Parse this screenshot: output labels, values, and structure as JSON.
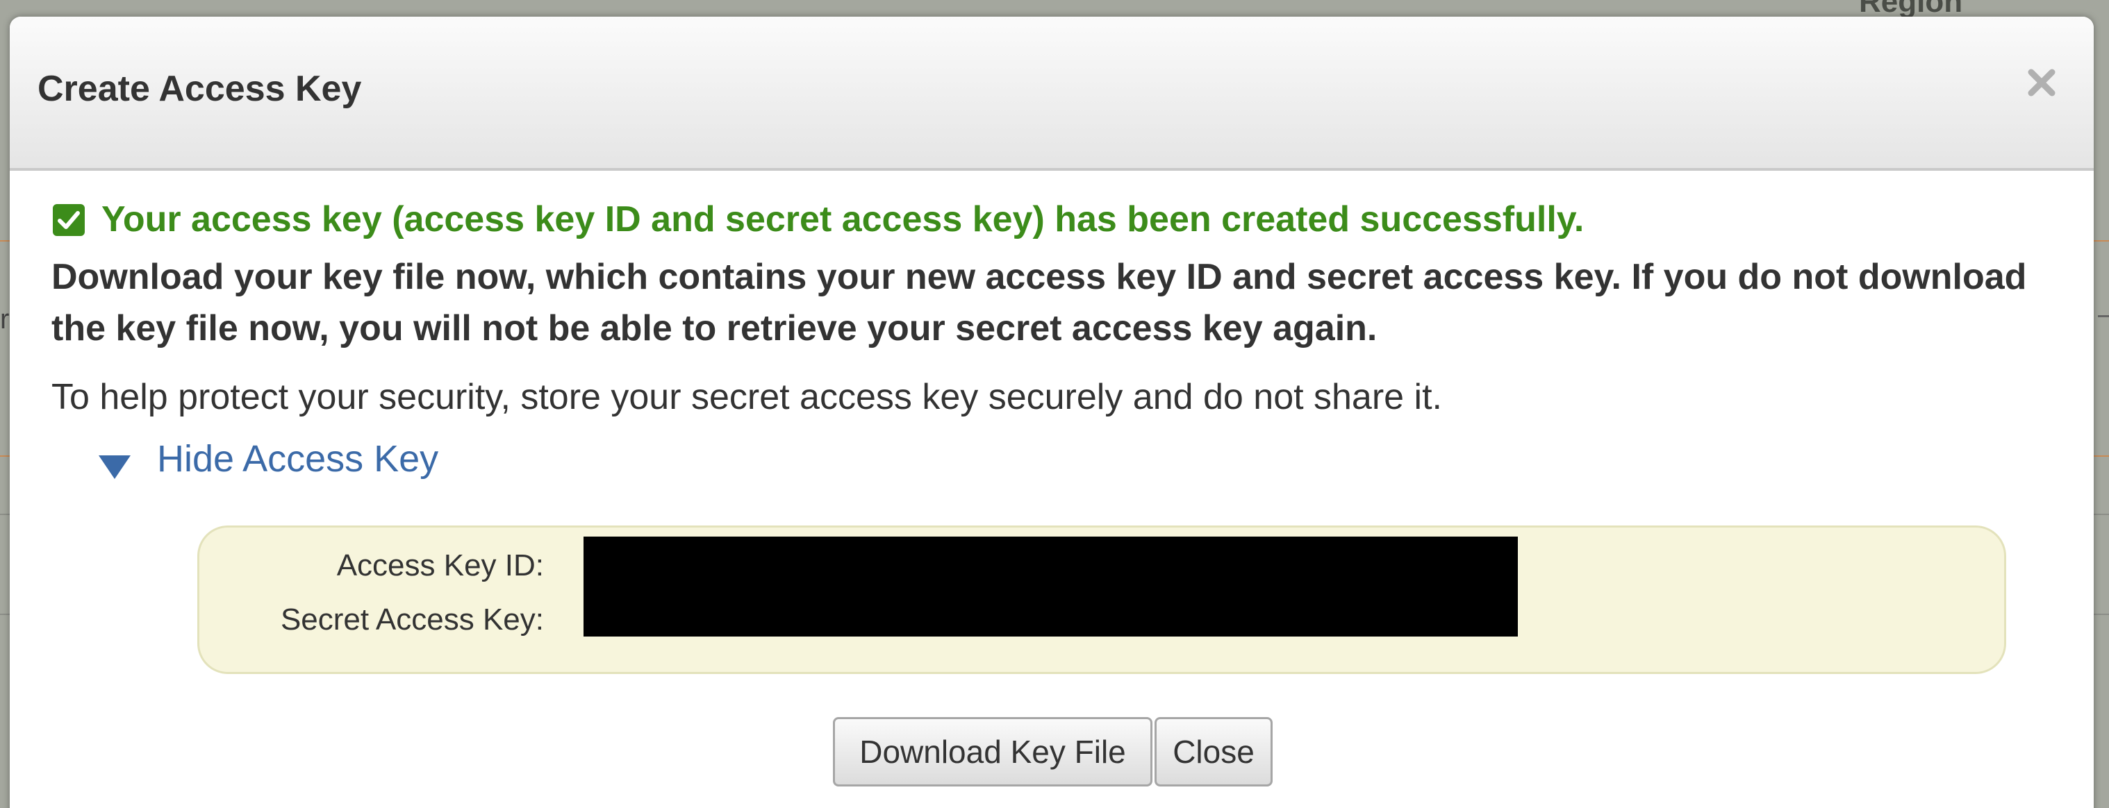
{
  "background": {
    "region_label": "Region",
    "left_char": "r"
  },
  "dialog": {
    "title": "Create Access Key",
    "close_icon": "close-x-icon",
    "success_message": "Your access key (access key ID and secret access key) has been created successfully.",
    "warning_message": "Download your key file now, which contains your new access key ID and secret access key. If you do not download the key file now, you will not be able to retrieve your secret access key again.",
    "security_note": "To help protect your security, store your secret access key securely and do not share it.",
    "toggle_label": "Hide Access Key",
    "key_box": {
      "access_key_id_label": "Access Key ID:",
      "secret_access_key_label": "Secret Access Key:",
      "values_redacted": true
    },
    "buttons": {
      "download": "Download Key File",
      "close": "Close"
    }
  },
  "colors": {
    "success": "#3c8c1a",
    "link": "#3b6aa8",
    "key_box_bg": "#f7f5dc",
    "text": "#333333"
  }
}
